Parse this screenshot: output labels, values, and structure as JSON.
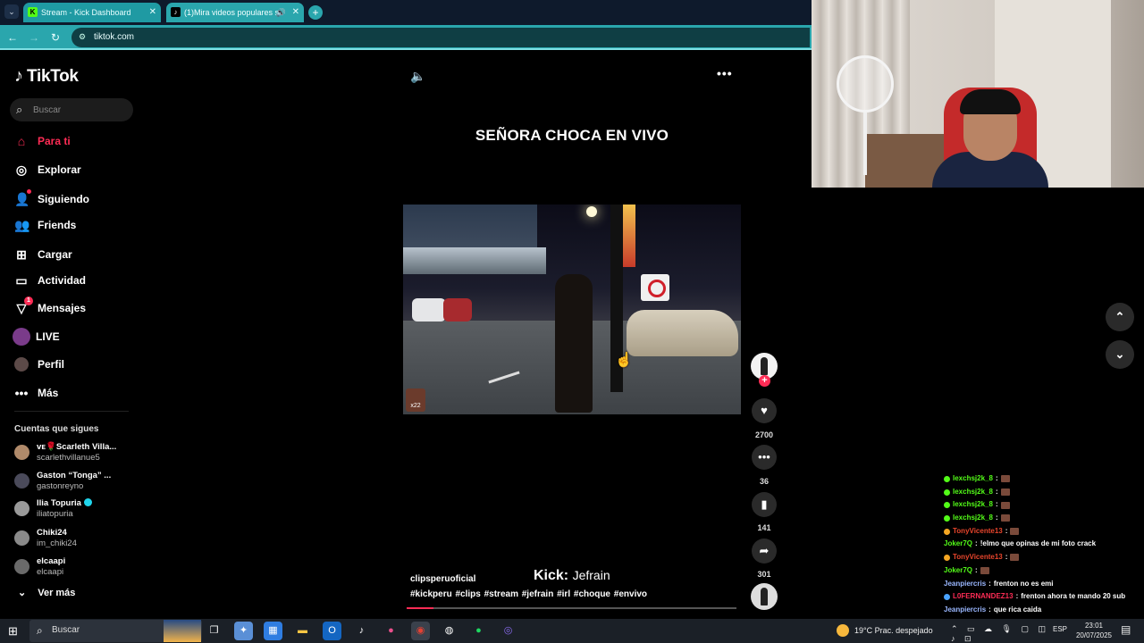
{
  "browser": {
    "tabs": [
      {
        "favicon": "K",
        "title": "Stream - Kick Dashboard"
      },
      {
        "favicon": "♪",
        "title": "(1)Mira videos populares s"
      }
    ],
    "url": "tiktok.com"
  },
  "tiktok": {
    "logo": "TikTok",
    "search_placeholder": "Buscar",
    "nav": [
      {
        "label": "Para ti",
        "icon": "home-icon",
        "active": true
      },
      {
        "label": "Explorar",
        "icon": "compass-icon"
      },
      {
        "label": "Siguiendo",
        "icon": "following-icon"
      },
      {
        "label": "Friends",
        "icon": "friends-icon"
      },
      {
        "label": "Cargar",
        "icon": "upload-icon"
      },
      {
        "label": "Actividad",
        "icon": "activity-icon"
      },
      {
        "label": "Mensajes",
        "icon": "messages-icon",
        "badge": "1"
      },
      {
        "label": "LIVE",
        "icon": "live-icon"
      },
      {
        "label": "Perfil",
        "icon": "profile-icon"
      },
      {
        "label": "Más",
        "icon": "more-icon"
      }
    ],
    "following_header": "Cuentas que sigues",
    "following": [
      {
        "name": "ᴠᴇ🌹Scarleth Villa...",
        "user": "scarlethvillanue5",
        "color": "#b08a6a"
      },
      {
        "name": "Gaston “Tonga” ...",
        "user": "gastonreyno",
        "color": "#4a4a5a"
      },
      {
        "name": "Ilia Topuria",
        "user": "iliatopuria",
        "color": "#9a9a9a",
        "verified": true
      },
      {
        "name": "Chiki24",
        "user": "im_chiki24",
        "color": "#8a8a8a"
      },
      {
        "name": "elcaapi",
        "user": "elcaapi",
        "color": "#6a6a6a"
      }
    ],
    "see_more": "Ver más"
  },
  "video": {
    "title": "SEÑORA CHOCA EN VIVO",
    "author": "clipsperuoficial",
    "overlay_label": "Kick:",
    "overlay_name": "Jefrain",
    "hashtags": "#kickperu #clips #stream #jefrain #irl #choque #envivo",
    "watermark": "x22",
    "progress": 0.08,
    "likes": "2700",
    "comments": "36",
    "saves": "141",
    "shares": "301"
  },
  "chat": [
    {
      "user": "lexchsj2k_8",
      "color": "#53fc18",
      "badge": "#53fc18",
      "msg": ""
    },
    {
      "user": "lexchsj2k_8",
      "color": "#53fc18",
      "badge": "#53fc18",
      "msg": ""
    },
    {
      "user": "lexchsj2k_8",
      "color": "#53fc18",
      "badge": "#53fc18",
      "msg": ""
    },
    {
      "user": "lexchsj2k_8",
      "color": "#53fc18",
      "badge": "#53fc18",
      "msg": ""
    },
    {
      "user": "TonyVicente13",
      "color": "#e8452c",
      "badge": "#f5a623",
      "msg": ""
    },
    {
      "user": "Joker7Q",
      "color": "#53fc18",
      "badge": "",
      "msg": "!elmo que opinas de mi foto crack"
    },
    {
      "user": "TonyVicente13",
      "color": "#e8452c",
      "badge": "#f5a623",
      "msg": ""
    },
    {
      "user": "Joker7Q",
      "color": "#53fc18",
      "badge": "",
      "msg": ""
    },
    {
      "user": "Jeanpiercris",
      "color": "#9ab7ff",
      "badge": "",
      "msg": "frenton no es emi"
    },
    {
      "user": "L0FERNANDEZ13",
      "color": "#fe2c55",
      "badge": "#4aa3ff",
      "msg": "frenton ahora te mando 20 sub"
    },
    {
      "user": "Jeanpiercris",
      "color": "#9ab7ff",
      "badge": "",
      "msg": "que rica caida"
    }
  ],
  "taskbar": {
    "search": "Buscar",
    "weather": "19°C  Prac. despejado",
    "lang": "ESP",
    "time": "23:01",
    "date": "20/07/2025"
  }
}
